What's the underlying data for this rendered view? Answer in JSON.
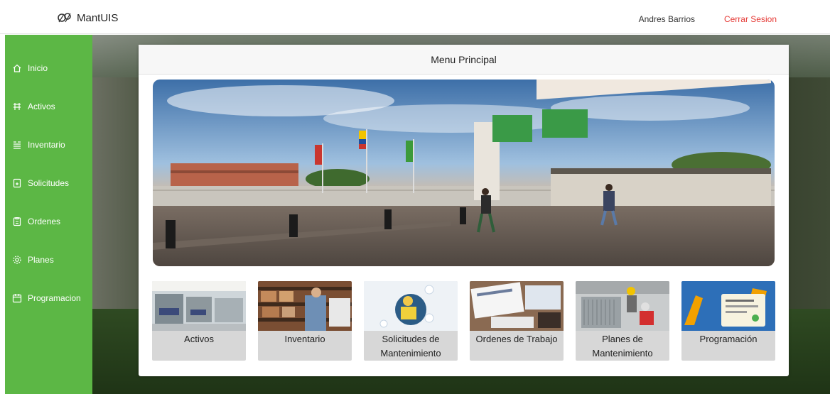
{
  "header": {
    "brand": "MantUIS",
    "user_name": "Andres Barrios",
    "logout_label": "Cerrar Sesion"
  },
  "sidebar": {
    "items": [
      {
        "label": "Inicio",
        "icon": "home-icon"
      },
      {
        "label": "Activos",
        "icon": "activos-icon"
      },
      {
        "label": "Inventario",
        "icon": "inventario-icon"
      },
      {
        "label": "Solicitudes",
        "icon": "solicitudes-icon"
      },
      {
        "label": "Ordenes",
        "icon": "ordenes-icon"
      },
      {
        "label": "Planes",
        "icon": "gear-icon"
      },
      {
        "label": "Programacion",
        "icon": "calendar-icon"
      }
    ]
  },
  "main": {
    "title": "Menu Principal",
    "tiles": [
      {
        "label": "Activos"
      },
      {
        "label": "Inventario"
      },
      {
        "label": "Solicitudes de Mantenimiento"
      },
      {
        "label": "Ordenes de Trabajo"
      },
      {
        "label": "Planes de Mantenimiento"
      },
      {
        "label": "Programación"
      }
    ]
  },
  "colors": {
    "sidebar": "#5cb745",
    "logout": "#e53935"
  }
}
